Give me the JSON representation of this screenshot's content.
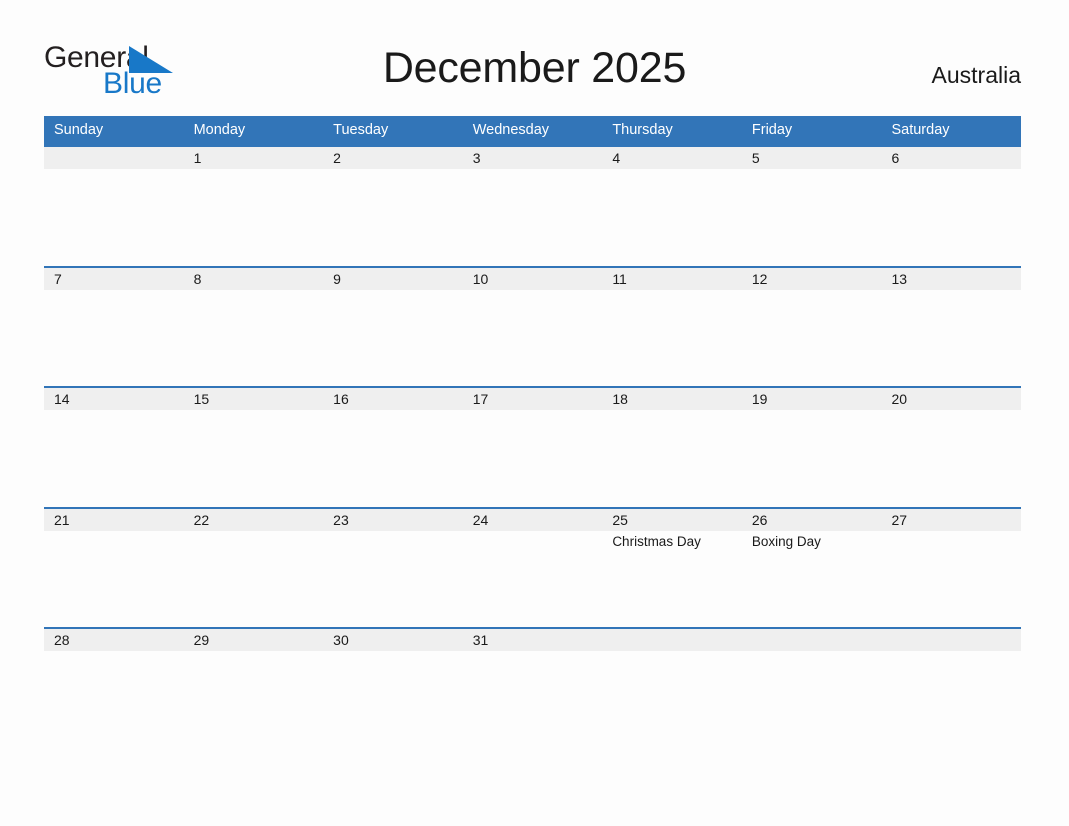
{
  "brand": {
    "name_part1": "General",
    "name_part2": "Blue",
    "triangle_icon": "triangle-icon",
    "accent_color": "#1878c8"
  },
  "header": {
    "title": "December 2025",
    "country": "Australia"
  },
  "theme": {
    "header_blue": "#3275b8",
    "band_gray": "#efefef",
    "page_background": "#fdfdfd",
    "text_color": "#1a1a1a"
  },
  "calendar": {
    "weekdays": [
      "Sunday",
      "Monday",
      "Tuesday",
      "Wednesday",
      "Thursday",
      "Friday",
      "Saturday"
    ],
    "weeks": [
      [
        {
          "day": "",
          "event": ""
        },
        {
          "day": "1",
          "event": ""
        },
        {
          "day": "2",
          "event": ""
        },
        {
          "day": "3",
          "event": ""
        },
        {
          "day": "4",
          "event": ""
        },
        {
          "day": "5",
          "event": ""
        },
        {
          "day": "6",
          "event": ""
        }
      ],
      [
        {
          "day": "7",
          "event": ""
        },
        {
          "day": "8",
          "event": ""
        },
        {
          "day": "9",
          "event": ""
        },
        {
          "day": "10",
          "event": ""
        },
        {
          "day": "11",
          "event": ""
        },
        {
          "day": "12",
          "event": ""
        },
        {
          "day": "13",
          "event": ""
        }
      ],
      [
        {
          "day": "14",
          "event": ""
        },
        {
          "day": "15",
          "event": ""
        },
        {
          "day": "16",
          "event": ""
        },
        {
          "day": "17",
          "event": ""
        },
        {
          "day": "18",
          "event": ""
        },
        {
          "day": "19",
          "event": ""
        },
        {
          "day": "20",
          "event": ""
        }
      ],
      [
        {
          "day": "21",
          "event": ""
        },
        {
          "day": "22",
          "event": ""
        },
        {
          "day": "23",
          "event": ""
        },
        {
          "day": "24",
          "event": ""
        },
        {
          "day": "25",
          "event": "Christmas Day"
        },
        {
          "day": "26",
          "event": "Boxing Day"
        },
        {
          "day": "27",
          "event": ""
        }
      ],
      [
        {
          "day": "28",
          "event": ""
        },
        {
          "day": "29",
          "event": ""
        },
        {
          "day": "30",
          "event": ""
        },
        {
          "day": "31",
          "event": ""
        },
        {
          "day": "",
          "event": ""
        },
        {
          "day": "",
          "event": ""
        },
        {
          "day": "",
          "event": ""
        }
      ]
    ]
  }
}
